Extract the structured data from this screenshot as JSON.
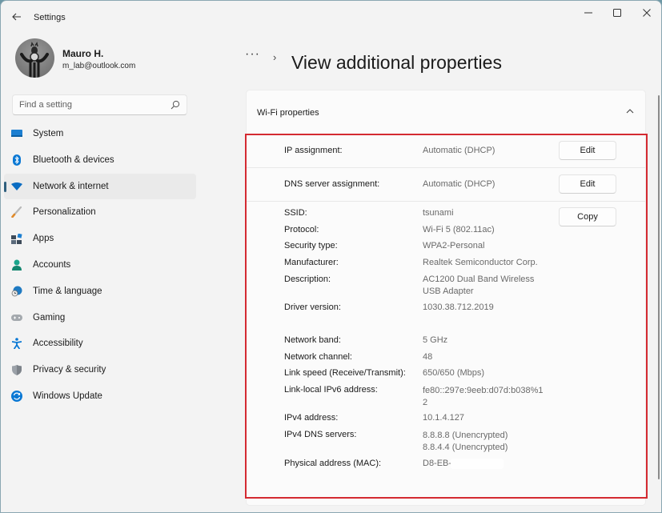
{
  "window": {
    "app_title": "Settings",
    "controls": {
      "minimize": "minimize",
      "maximize": "maximize",
      "close": "close"
    }
  },
  "profile": {
    "name": "Mauro H.",
    "email": "m_lab@outlook.com"
  },
  "search": {
    "placeholder": "Find a setting",
    "value": ""
  },
  "sidebar": {
    "selected": "Network & internet",
    "items": [
      {
        "label": "System",
        "icon": "monitor-icon",
        "color": "#0a6cc2"
      },
      {
        "label": "Bluetooth & devices",
        "icon": "bluetooth-icon",
        "color": "#0a78d4"
      },
      {
        "label": "Network & internet",
        "icon": "wifi-icon",
        "color": "#0a78d4"
      },
      {
        "label": "Personalization",
        "icon": "brush-icon",
        "color": "#e08a2a"
      },
      {
        "label": "Apps",
        "icon": "apps-icon",
        "color": "#4a5a6a"
      },
      {
        "label": "Accounts",
        "icon": "person-icon",
        "color": "#1aa58c"
      },
      {
        "label": "Time & language",
        "icon": "globe-clock-icon",
        "color": "#1f7ac2"
      },
      {
        "label": "Gaming",
        "icon": "gamepad-icon",
        "color": "#9aa0a6"
      },
      {
        "label": "Accessibility",
        "icon": "accessibility-icon",
        "color": "#0a78d4"
      },
      {
        "label": "Privacy & security",
        "icon": "shield-icon",
        "color": "#8a8f96"
      },
      {
        "label": "Windows Update",
        "icon": "update-icon",
        "color": "#0a78d4"
      }
    ]
  },
  "header": {
    "breadcrumb_more": "···",
    "breadcrumb_separator": "›",
    "title": "View additional properties"
  },
  "card": {
    "title": "Wi-Fi properties",
    "expanded": true,
    "settings": [
      {
        "label": "IP assignment:",
        "value": "Automatic (DHCP)",
        "button": "Edit"
      },
      {
        "label": "DNS server assignment:",
        "value": "Automatic (DHCP)",
        "button": "Edit"
      }
    ],
    "copy_button": "Copy",
    "properties": [
      {
        "label": "SSID:",
        "value": "tsunami"
      },
      {
        "label": "Protocol:",
        "value": "Wi-Fi 5 (802.11ac)"
      },
      {
        "label": "Security type:",
        "value": "WPA2-Personal"
      },
      {
        "label": "Manufacturer:",
        "value": "Realtek Semiconductor Corp."
      },
      {
        "label": "Description:",
        "value": "AC1200  Dual Band Wireless",
        "value2": "USB Adapter"
      },
      {
        "label": "Driver version:",
        "value": "1030.38.712.2019"
      },
      {
        "label": "Network band:",
        "value": "5 GHz"
      },
      {
        "label": "Network channel:",
        "value": "48"
      },
      {
        "label": "Link speed (Receive/Transmit):",
        "value": "650/650 (Mbps)"
      },
      {
        "label": "Link-local IPv6 address:",
        "value": "fe80::297e:9eeb:d07d:b038%1",
        "value2": "2"
      },
      {
        "label": "IPv4 address:",
        "value": "10.1.4.127"
      },
      {
        "label": "IPv4 DNS servers:",
        "value": "8.8.8.8 (Unencrypted)",
        "value2": "8.8.4.4 (Unencrypted)"
      },
      {
        "label": "Physical address (MAC):",
        "value": "D8-EB-"
      }
    ]
  },
  "highlight_color": "#d42a31",
  "accent_color": "#2f5f7e"
}
